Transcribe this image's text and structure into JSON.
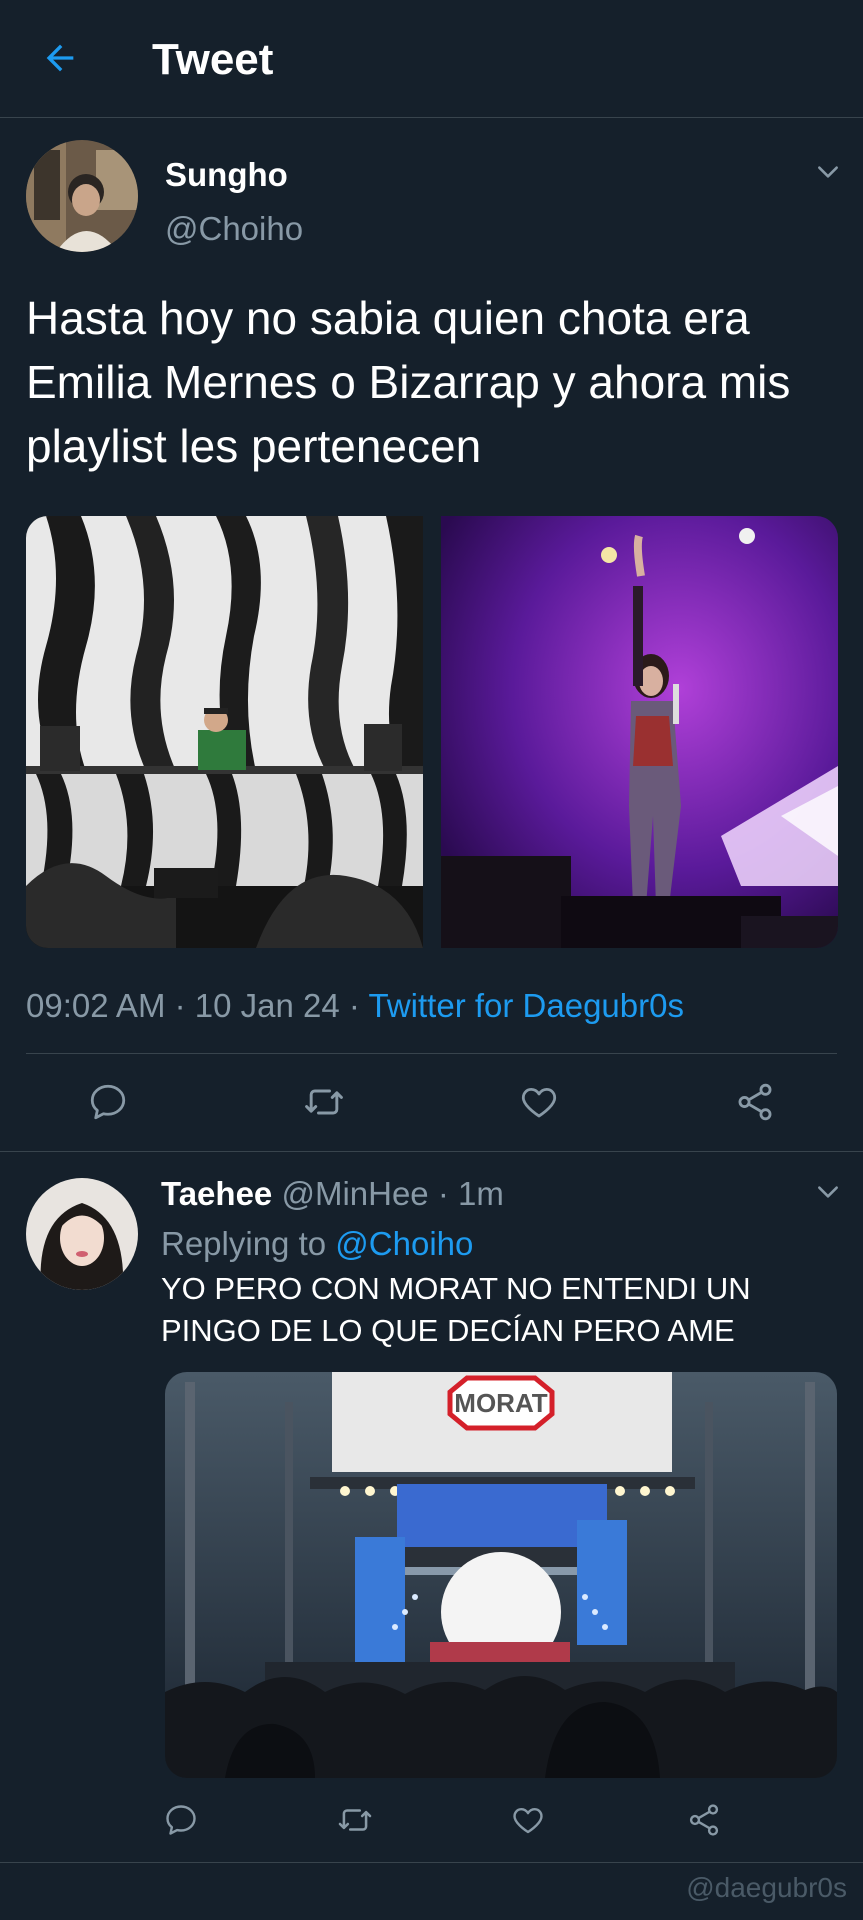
{
  "header": {
    "title": "Tweet",
    "back_icon": "arrow-left-icon"
  },
  "tweet": {
    "author_name": "Sungho",
    "handle": "@Choiho",
    "text": "Hasta hoy no sabia quien chota era Emilia Mernes o Bizarrap y ahora mis playlist les pertenecen",
    "time": "09:02 AM",
    "sep1": "·",
    "date": "10 Jan 24",
    "sep2": "·",
    "client": "Twitter for Daegubr0s",
    "images": [
      "dj-on-stage-photo",
      "singer-on-stage-photo"
    ],
    "actions": [
      "reply-icon",
      "retweet-icon",
      "like-icon",
      "share-icon"
    ]
  },
  "reply": {
    "author_name": "Taehee",
    "handle": "@MinHee",
    "sep": "·",
    "time": "1m",
    "replying_label": "Replying to",
    "replying_handle": "@Choiho",
    "text": "YO PERO CON MORAT NO ENTENDI UN PINGO DE LO QUE DECÍAN PERO AME",
    "image_sign": "MORAT",
    "actions": [
      "reply-icon",
      "retweet-icon",
      "like-icon",
      "share-icon"
    ]
  },
  "watermark": "@daegubr0s",
  "colors": {
    "background": "#15202b",
    "accent": "#1d9bf0",
    "muted": "#8899a6",
    "divider": "#38444d"
  }
}
